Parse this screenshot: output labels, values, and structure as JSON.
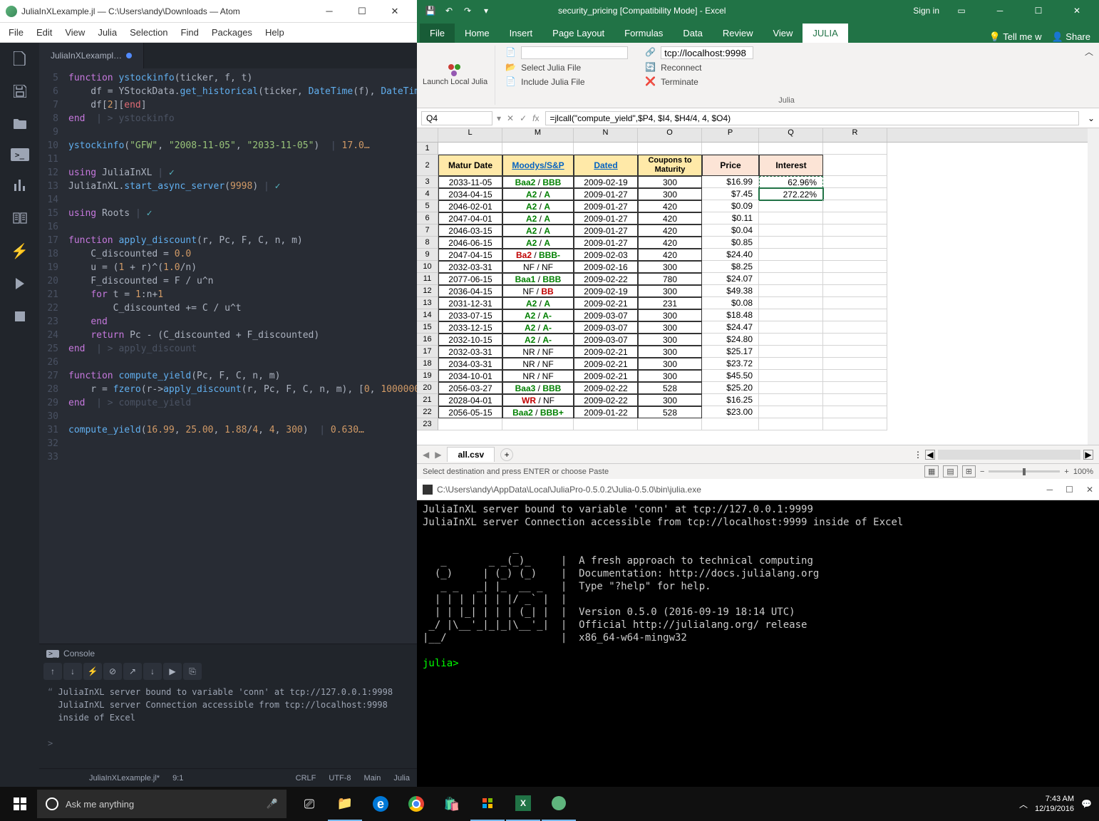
{
  "atom": {
    "title": "JuliaInXLexample.jl — C:\\Users\\andy\\Downloads — Atom",
    "menu": [
      "File",
      "Edit",
      "View",
      "Julia",
      "Selection",
      "Find",
      "Packages",
      "Help"
    ],
    "tab": "JuliaInXLexampl…",
    "code_lines": [
      5,
      6,
      7,
      8,
      9,
      10,
      11,
      12,
      13,
      14,
      15,
      16,
      17,
      18,
      19,
      20,
      21,
      22,
      23,
      24,
      25,
      26,
      27,
      28,
      29,
      30,
      31,
      32,
      33
    ],
    "console_title": "Console",
    "console_lines": [
      "JuliaInXL server bound to variable 'conn' at tcp://127.0.0.1:9998",
      "JuliaInXL server Connection accessible from tcp://localhost:9998",
      "inside of Excel"
    ],
    "status": {
      "file": "JuliaInXLexample.jl*",
      "pos": "9:1",
      "crlf": "CRLF",
      "enc": "UTF-8",
      "branch": "Main",
      "lang": "Julia"
    }
  },
  "excel": {
    "title": "security_pricing  [Compatibility Mode] - Excel",
    "signin": "Sign in",
    "tabs": [
      "File",
      "Home",
      "Insert",
      "Page Layout",
      "Formulas",
      "Data",
      "Review",
      "View",
      "JULIA"
    ],
    "tellme": "Tell me w",
    "share": "Share",
    "ribbon": {
      "launch": "Launch Local Julia",
      "items1": [
        "Select Julia File",
        "Include Julia File"
      ],
      "tcp": "tcp://localhost:9998",
      "items2": [
        "Reconnect",
        "Terminate"
      ],
      "group": "Julia"
    },
    "namebox": "Q4",
    "formula": "=jlcall(\"compute_yield\",$P4, $I4, $H4/4, 4, $O4)",
    "cols": [
      "L",
      "M",
      "N",
      "O",
      "P",
      "Q",
      "R"
    ],
    "headers": [
      "Matur Date",
      "Moodys/S&P",
      "Dated",
      "Coupons to Maturity",
      "Price",
      "Interest"
    ],
    "rows": [
      {
        "n": 3,
        "matur": "2033-11-05",
        "rat": [
          {
            "t": "Baa2",
            "c": "g"
          },
          {
            "t": " / ",
            "c": "b"
          },
          {
            "t": "BBB",
            "c": "g"
          }
        ],
        "dated": "2009-02-19",
        "cpn": "300",
        "price": "$16.99",
        "int": "62.96%"
      },
      {
        "n": 4,
        "matur": "2034-04-15",
        "rat": [
          {
            "t": "A2",
            "c": "g"
          },
          {
            "t": " / ",
            "c": "b"
          },
          {
            "t": "A",
            "c": "g"
          }
        ],
        "dated": "2009-01-27",
        "cpn": "300",
        "price": "$7.45",
        "int": "272.22%"
      },
      {
        "n": 5,
        "matur": "2046-02-01",
        "rat": [
          {
            "t": "A2",
            "c": "g"
          },
          {
            "t": " / ",
            "c": "b"
          },
          {
            "t": "A",
            "c": "g"
          }
        ],
        "dated": "2009-01-27",
        "cpn": "420",
        "price": "$0.09",
        "int": ""
      },
      {
        "n": 6,
        "matur": "2047-04-01",
        "rat": [
          {
            "t": "A2",
            "c": "g"
          },
          {
            "t": " / ",
            "c": "b"
          },
          {
            "t": "A",
            "c": "g"
          }
        ],
        "dated": "2009-01-27",
        "cpn": "420",
        "price": "$0.11",
        "int": ""
      },
      {
        "n": 7,
        "matur": "2046-03-15",
        "rat": [
          {
            "t": "A2",
            "c": "g"
          },
          {
            "t": " / ",
            "c": "b"
          },
          {
            "t": "A",
            "c": "g"
          }
        ],
        "dated": "2009-01-27",
        "cpn": "420",
        "price": "$0.04",
        "int": ""
      },
      {
        "n": 8,
        "matur": "2046-06-15",
        "rat": [
          {
            "t": "A2",
            "c": "g"
          },
          {
            "t": " / ",
            "c": "b"
          },
          {
            "t": "A",
            "c": "g"
          }
        ],
        "dated": "2009-01-27",
        "cpn": "420",
        "price": "$0.85",
        "int": ""
      },
      {
        "n": 9,
        "matur": "2047-04-15",
        "rat": [
          {
            "t": "Ba2",
            "c": "r"
          },
          {
            "t": " / ",
            "c": "b"
          },
          {
            "t": "BBB-",
            "c": "g"
          }
        ],
        "dated": "2009-02-03",
        "cpn": "420",
        "price": "$24.40",
        "int": ""
      },
      {
        "n": 10,
        "matur": "2032-03-31",
        "rat": [
          {
            "t": "NF / NF",
            "c": "b"
          }
        ],
        "dated": "2009-02-16",
        "cpn": "300",
        "price": "$8.25",
        "int": ""
      },
      {
        "n": 11,
        "matur": "2077-06-15",
        "rat": [
          {
            "t": "Baa1",
            "c": "g"
          },
          {
            "t": " / ",
            "c": "b"
          },
          {
            "t": "BBB",
            "c": "g"
          }
        ],
        "dated": "2009-02-22",
        "cpn": "780",
        "price": "$24.07",
        "int": ""
      },
      {
        "n": 12,
        "matur": "2036-04-15",
        "rat": [
          {
            "t": "NF",
            "c": "b"
          },
          {
            "t": " / ",
            "c": "b"
          },
          {
            "t": "BB",
            "c": "r"
          }
        ],
        "dated": "2009-02-19",
        "cpn": "300",
        "price": "$49.38",
        "int": ""
      },
      {
        "n": 13,
        "matur": "2031-12-31",
        "rat": [
          {
            "t": "A2",
            "c": "g"
          },
          {
            "t": " / ",
            "c": "b"
          },
          {
            "t": "A",
            "c": "g"
          }
        ],
        "dated": "2009-02-21",
        "cpn": "231",
        "price": "$0.08",
        "int": ""
      },
      {
        "n": 14,
        "matur": "2033-07-15",
        "rat": [
          {
            "t": "A2",
            "c": "g"
          },
          {
            "t": " / ",
            "c": "b"
          },
          {
            "t": "A-",
            "c": "g"
          }
        ],
        "dated": "2009-03-07",
        "cpn": "300",
        "price": "$18.48",
        "int": ""
      },
      {
        "n": 15,
        "matur": "2033-12-15",
        "rat": [
          {
            "t": "A2",
            "c": "g"
          },
          {
            "t": " / ",
            "c": "b"
          },
          {
            "t": "A-",
            "c": "g"
          }
        ],
        "dated": "2009-03-07",
        "cpn": "300",
        "price": "$24.47",
        "int": ""
      },
      {
        "n": 16,
        "matur": "2032-10-15",
        "rat": [
          {
            "t": "A2",
            "c": "g"
          },
          {
            "t": " / ",
            "c": "b"
          },
          {
            "t": "A-",
            "c": "g"
          }
        ],
        "dated": "2009-03-07",
        "cpn": "300",
        "price": "$24.80",
        "int": ""
      },
      {
        "n": 17,
        "matur": "2032-03-31",
        "rat": [
          {
            "t": "NR / NF",
            "c": "b"
          }
        ],
        "dated": "2009-02-21",
        "cpn": "300",
        "price": "$25.17",
        "int": ""
      },
      {
        "n": 18,
        "matur": "2034-03-31",
        "rat": [
          {
            "t": "NR / NF",
            "c": "b"
          }
        ],
        "dated": "2009-02-21",
        "cpn": "300",
        "price": "$23.72",
        "int": ""
      },
      {
        "n": 19,
        "matur": "2034-10-01",
        "rat": [
          {
            "t": "NR / NF",
            "c": "b"
          }
        ],
        "dated": "2009-02-21",
        "cpn": "300",
        "price": "$45.50",
        "int": ""
      },
      {
        "n": 20,
        "matur": "2056-03-27",
        "rat": [
          {
            "t": "Baa3",
            "c": "g"
          },
          {
            "t": " / ",
            "c": "b"
          },
          {
            "t": "BBB",
            "c": "g"
          }
        ],
        "dated": "2009-02-22",
        "cpn": "528",
        "price": "$25.20",
        "int": ""
      },
      {
        "n": 21,
        "matur": "2028-04-01",
        "rat": [
          {
            "t": "WR",
            "c": "r"
          },
          {
            "t": " / NF",
            "c": "b"
          }
        ],
        "dated": "2009-02-22",
        "cpn": "300",
        "price": "$16.25",
        "int": ""
      },
      {
        "n": 22,
        "matur": "2056-05-15",
        "rat": [
          {
            "t": "Baa2",
            "c": "g"
          },
          {
            "t": " / ",
            "c": "b"
          },
          {
            "t": "BBB+",
            "c": "g"
          }
        ],
        "dated": "2009-01-22",
        "cpn": "528",
        "price": "$23.00",
        "int": ""
      }
    ],
    "sheet_tab": "all.csv",
    "statusbar": "Select destination and press ENTER or choose Paste",
    "zoom": "100%"
  },
  "terminal": {
    "title": "C:\\Users\\andy\\AppData\\Local\\JuliaPro-0.5.0.2\\Julia-0.5.0\\bin\\julia.exe",
    "lines": [
      "JuliaInXL server bound to variable 'conn' at tcp://127.0.0.1:9999",
      "JuliaInXL server Connection accessible from tcp://localhost:9999 inside of Excel",
      "",
      "               _",
      "   _       _ _(_)_     |  A fresh approach to technical computing",
      "  (_)     | (_) (_)    |  Documentation: http://docs.julialang.org",
      "   _ _   _| |_  __ _   |  Type \"?help\" for help.",
      "  | | | | | | |/ _` |  |",
      "  | | |_| | | | (_| |  |  Version 0.5.0 (2016-09-19 18:14 UTC)",
      " _/ |\\__'_|_|_|\\__'_|  |  Official http://julialang.org/ release",
      "|__/                   |  x86_64-w64-mingw32",
      ""
    ],
    "prompt": "julia>"
  },
  "taskbar": {
    "search_placeholder": "Ask me anything",
    "time": "7:43 AM",
    "date": "12/19/2016"
  }
}
